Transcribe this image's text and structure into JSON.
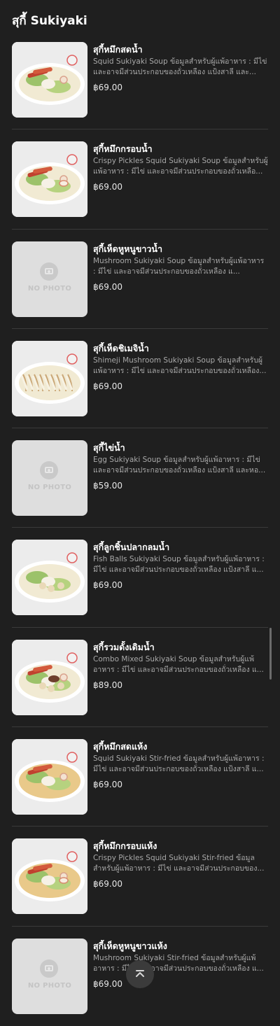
{
  "section": {
    "title": "สุกี้ Sukiyaki"
  },
  "items": [
    {
      "name": "สุกี้หมึกสดน้ำ",
      "desc": "Squid Sukiyaki Soup ข้อมูลสำหรับผู้แพ้อาหาร : มีไข่ และอาจมีส่วนประกอบของถั่วเหลือง แป้งสาลี และ...",
      "price": "฿69.00",
      "photo": "squid-soup"
    },
    {
      "name": "สุกี้หมึกกรอบน้ำ",
      "desc": "Crispy Pickles Squid Sukiyaki Soup ข้อมูลสำหรับผู้แพ้อาหาร : มีไข่ และอาจมีส่วนประกอบของถั่วเหลือ...",
      "price": "฿69.00",
      "photo": "crispy-squid-soup"
    },
    {
      "name": "สุกี้เห็ดหูหนูขาวน้ำ",
      "desc": "Mushroom Sukiyaki Soup ข้อมูลสำหรับผู้แพ้อาหาร : มีไข่ และอาจมีส่วนประกอบของถั่วเหลือง แ...",
      "price": "฿69.00",
      "photo": "none"
    },
    {
      "name": "สุกี้เห็ดชิเมจิน้ำ",
      "desc": "Shimeji Mushroom Sukiyaki Soup ข้อมูลสำหรับผู้แพ้อาหาร : มีไข่ และอาจมีส่วนประกอบของถั่วเหลือง...",
      "price": "฿69.00",
      "photo": "shimeji-soup"
    },
    {
      "name": "สุกี้ไข่น้ำ",
      "desc": "Egg Sukiyaki Soup ข้อมูลสำหรับผู้แพ้อาหาร : มีไข่ และอาจมีส่วนประกอบของถั่วเหลือง แป้งสาลี และหอ...",
      "price": "฿59.00",
      "photo": "none"
    },
    {
      "name": "สุกี้ลูกชิ้นปลากลมน้ำ",
      "desc": "Fish Balls Sukiyaki Soup ข้อมูลสำหรับผู้แพ้อาหาร : มีไข่ และอาจมีส่วนประกอบของถั่วเหลือง แป้งสาลี แ...",
      "price": "฿69.00",
      "photo": "fishball-soup"
    },
    {
      "name": "สุกี้รวมดั้งเดิมน้ำ",
      "desc": "Combo Mixed Sukiyaki Soup ข้อมูลสำหรับผู้แพ้อาหาร : มีไข่ และอาจมีส่วนประกอบของถั่วเหลือง แ...",
      "price": "฿89.00",
      "photo": "combo-soup"
    },
    {
      "name": "สุกี้หมึกสดแห้ง",
      "desc": "Squid Sukiyaki Stir-fried ข้อมูลสำหรับผู้แพ้อาหาร : มีไข่ และอาจมีส่วนประกอบของถั่วเหลือง แป้งสาลี แ...",
      "price": "฿69.00",
      "photo": "squid-dry"
    },
    {
      "name": "สุกี้หมึกกรอบแห้ง",
      "desc": "Crispy Pickles Squid Sukiyaki Stir-fried ข้อมูลสำหรับผู้แพ้อาหาร : มีไข่ และอาจมีส่วนประกอบของ...",
      "price": "฿69.00",
      "photo": "crispy-squid-dry"
    },
    {
      "name": "สุกี้เห็ดหูหนูขาวแห้ง",
      "desc": "Mushroom Sukiyaki Stir-fried ข้อมูลสำหรับผู้แพ้อาหาร : มีไข่ และอาจมีส่วนประกอบของถั่วเหลือง แ...",
      "price": "฿69.00",
      "photo": "none"
    }
  ],
  "no_photo_label": "NO PHOTO",
  "icons": {
    "scroll_top": "chevron-up-icon",
    "no_photo": "camera-icon"
  },
  "colors": {
    "background": "#1f1f1f",
    "divider": "#3a3a3a",
    "desc_text": "#a9a9a9"
  }
}
